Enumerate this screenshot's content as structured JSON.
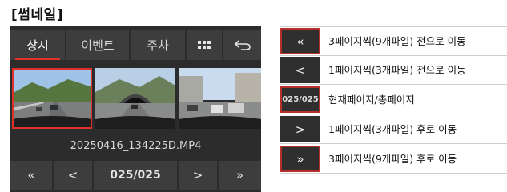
{
  "title": "[썸네일]",
  "tabs": [
    {
      "label": "상시",
      "active": true
    },
    {
      "label": "이벤트",
      "active": false
    },
    {
      "label": "주차",
      "active": false
    }
  ],
  "toolbar": {
    "grid_icon": "grid-icon",
    "back_icon": "back-arrow-icon"
  },
  "thumbnails": [
    {
      "scene": "highway",
      "selected": true
    },
    {
      "scene": "tunnel-entrance",
      "selected": false
    },
    {
      "scene": "city-road",
      "selected": false
    }
  ],
  "filename": "20250416_134225D.MP4",
  "nav": {
    "first_label": "«",
    "prev_label": "<",
    "page": "025/025",
    "next_label": ">",
    "last_label": "»"
  },
  "legend": [
    {
      "icon": "«",
      "desc": "3페이지씩(9개파일) 전으로 이동"
    },
    {
      "icon": "<",
      "desc": "1페이지씩(3개파일) 전으로 이동"
    },
    {
      "icon": "025/025",
      "desc": "현재페이지/총페이지"
    },
    {
      "icon": ">",
      "desc": "1페이지씩(3개파일) 후로 이동"
    },
    {
      "icon": "»",
      "desc": "3페이지씩(9개파일) 후로 이동"
    }
  ],
  "colors": {
    "accent": "#e0302a",
    "panel": "#2c2c2c",
    "button": "#3d3d3d"
  }
}
